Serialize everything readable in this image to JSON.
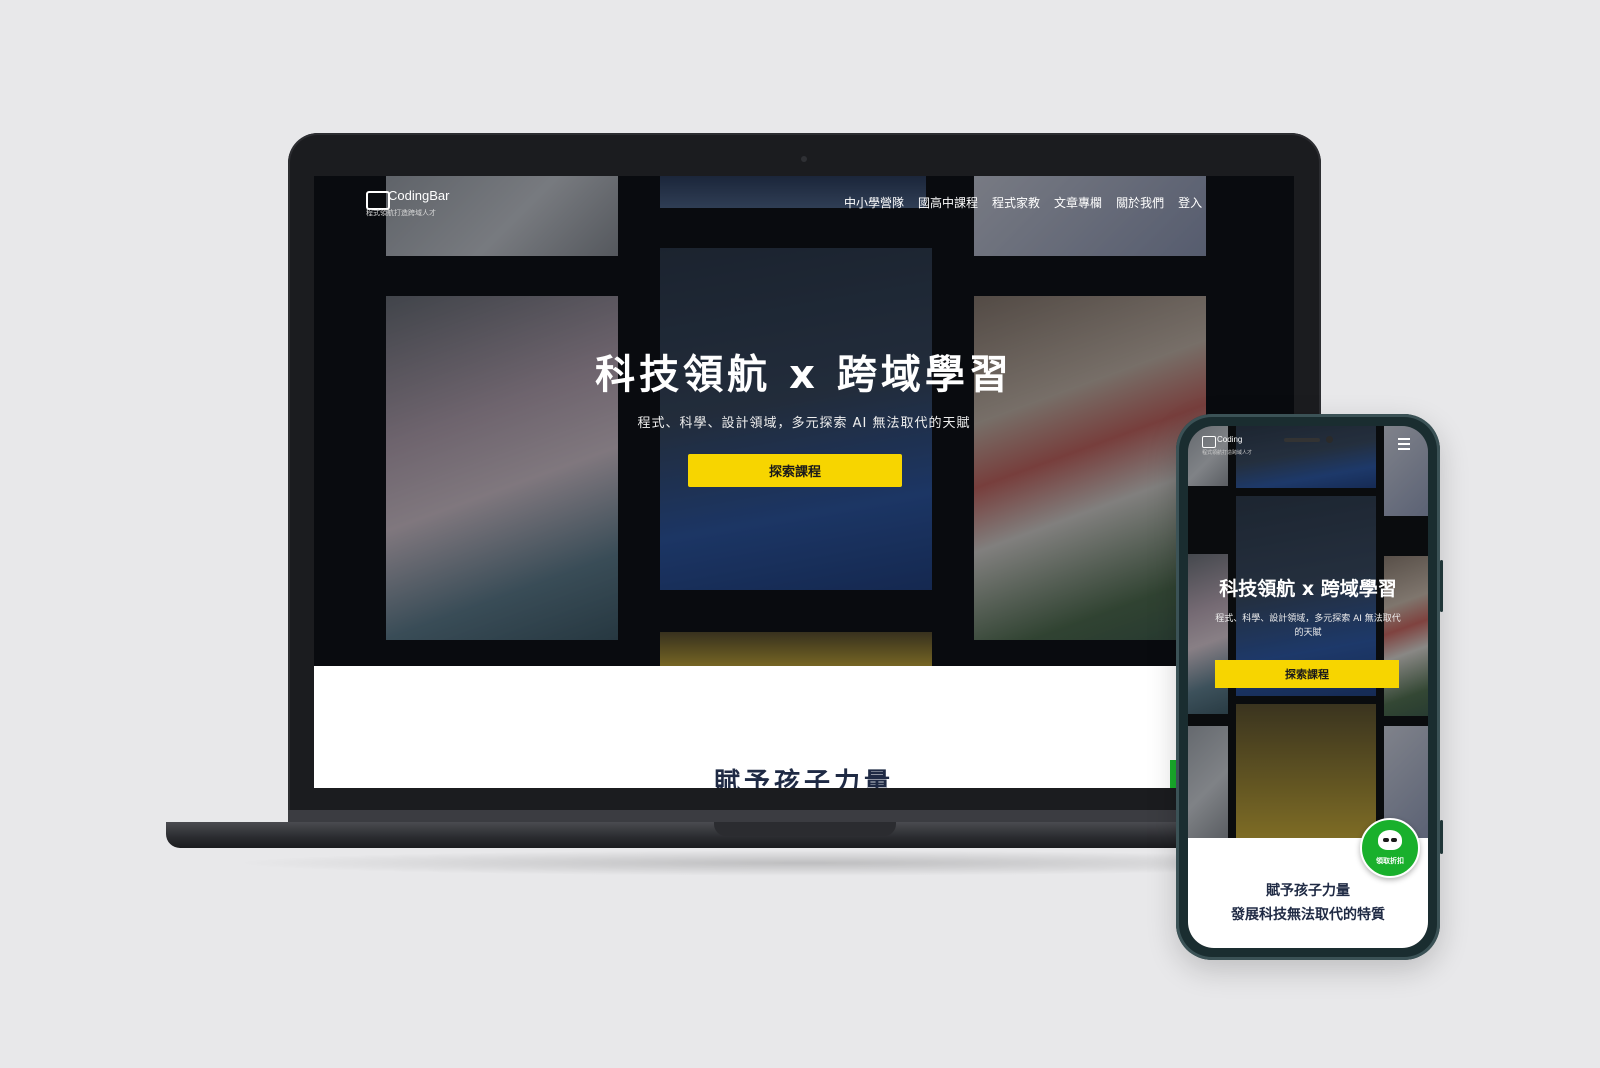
{
  "site": {
    "brand": "CodingBar",
    "tagline": "程式領航打造跨域人才"
  },
  "nav": {
    "items": [
      "中小學營隊",
      "國高中課程",
      "程式家教",
      "文章專欄",
      "關於我們",
      "登入"
    ]
  },
  "hero": {
    "title": "科技領航 x 跨域學習",
    "subtitle": "程式、科學、設計領域，多元探索 AI 無法取代的天賦",
    "cta": "探索課程"
  },
  "section": {
    "heading_line1": "賦予孩子力量",
    "heading_line2": "發展科技無法取代的特質"
  },
  "mobile": {
    "brand": "Coding",
    "tagline": "程式領航打造跨域人才",
    "subtitle_line1": "程式、科學、設計領域，多元探索 AI 無法取代",
    "subtitle_line2": "的天賦",
    "badge": "領取折扣"
  },
  "colors": {
    "cta_yellow": "#f7d500",
    "badge_green": "#19b02c",
    "heading_navy": "#1f2a44"
  }
}
